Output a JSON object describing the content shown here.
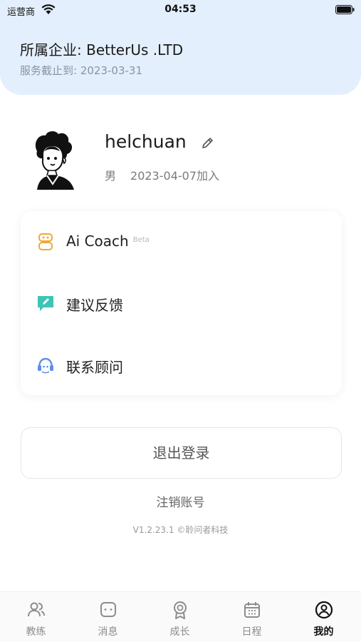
{
  "status_bar": {
    "carrier": "运营商",
    "time": "04:53"
  },
  "header": {
    "company": "所属企业: BetterUs .LTD",
    "service_until": "服务截止到: 2023-03-31"
  },
  "profile": {
    "username": "helchuan",
    "gender": "男",
    "joined": "2023-04-07加入"
  },
  "menu": [
    {
      "label": "Ai Coach",
      "badge": "Beta",
      "icon": "robot-icon"
    },
    {
      "label": "建议反馈",
      "icon": "feedback-icon"
    },
    {
      "label": "联系顾问",
      "icon": "headset-icon"
    }
  ],
  "actions": {
    "logout": "退出登录",
    "cancel_account": "注销账号"
  },
  "version": "V1.2.23.1 ©聆问者科技",
  "tabs": [
    {
      "label": "教练",
      "icon": "people-icon"
    },
    {
      "label": "消息",
      "icon": "message-icon"
    },
    {
      "label": "成长",
      "icon": "medal-icon"
    },
    {
      "label": "日程",
      "icon": "calendar-icon"
    },
    {
      "label": "我的",
      "icon": "user-icon",
      "active": true
    }
  ],
  "colors": {
    "header_bg": "#e3effc",
    "ai_coach_icon": "#f0a836",
    "feedback_icon": "#3ec4b4",
    "headset_icon": "#5b8fe8"
  }
}
